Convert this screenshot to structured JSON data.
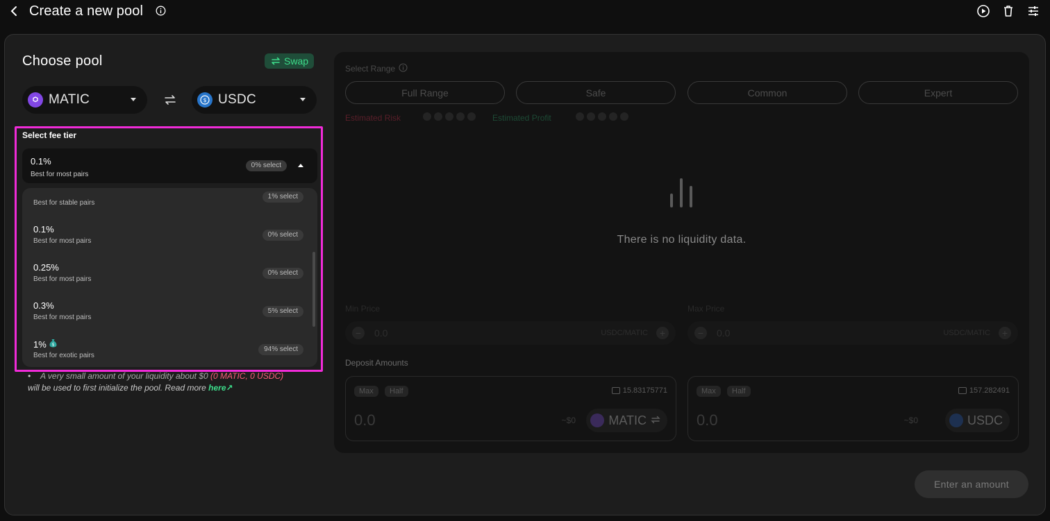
{
  "header": {
    "title": "Create a new pool"
  },
  "choose_pool": {
    "title": "Choose pool",
    "swap_label": "Swap",
    "token_a": "MATIC",
    "token_b": "USDC"
  },
  "fee_tier": {
    "title": "Select fee tier",
    "selected": {
      "pct": "0.1%",
      "desc": "Best for most pairs",
      "badge": "0% select"
    },
    "options": [
      {
        "pct": "",
        "desc": "Best for stable pairs",
        "badge": "1% select"
      },
      {
        "pct": "0.1%",
        "desc": "Best for most pairs",
        "badge": "0% select"
      },
      {
        "pct": "0.25%",
        "desc": "Best for most pairs",
        "badge": "0% select"
      },
      {
        "pct": "0.3%",
        "desc": "Best for most pairs",
        "badge": "5% select"
      },
      {
        "pct": "1%",
        "desc": "Best for exotic pairs",
        "badge": "94% select"
      }
    ]
  },
  "note": {
    "line1_prefix": "A very small amount of your liquidity about $0",
    "line1_highlight": "(0 MATIC, 0 USDC)",
    "line2_prefix": "will be used to first initialize the pool. Read more",
    "link": "here↗"
  },
  "range": {
    "title": "Select Range",
    "tabs": [
      "Full Range",
      "Safe",
      "Common",
      "Expert"
    ],
    "risk_label": "Estimated Risk",
    "profit_label": "Estimated Profit",
    "empty_text": "There is no liquidity data.",
    "min_price_label": "Min Price",
    "max_price_label": "Max Price",
    "min_price_value": "0.0",
    "max_price_value": "0.0",
    "price_unit": "USDC/MATIC",
    "colors": {
      "risk": "#5a1f2a",
      "profit": "#1d4a35"
    }
  },
  "deposit": {
    "title": "Deposit Amounts",
    "max_label": "Max",
    "half_label": "Half",
    "a": {
      "balance": "15.83175771",
      "amount": "0.0",
      "usd": "~$0",
      "token": "MATIC"
    },
    "b": {
      "balance": "157.282491",
      "amount": "0.0",
      "usd": "~$0",
      "token": "USDC"
    }
  },
  "actions": {
    "enter_amount": "Enter an amount"
  },
  "icons": [
    "chevron-left-icon",
    "info-icon",
    "play-circle-icon",
    "trash-icon",
    "sliders-icon",
    "swap-icon",
    "flip-icon",
    "wallet-icon",
    "bars-icon",
    "money-bag-icon"
  ]
}
